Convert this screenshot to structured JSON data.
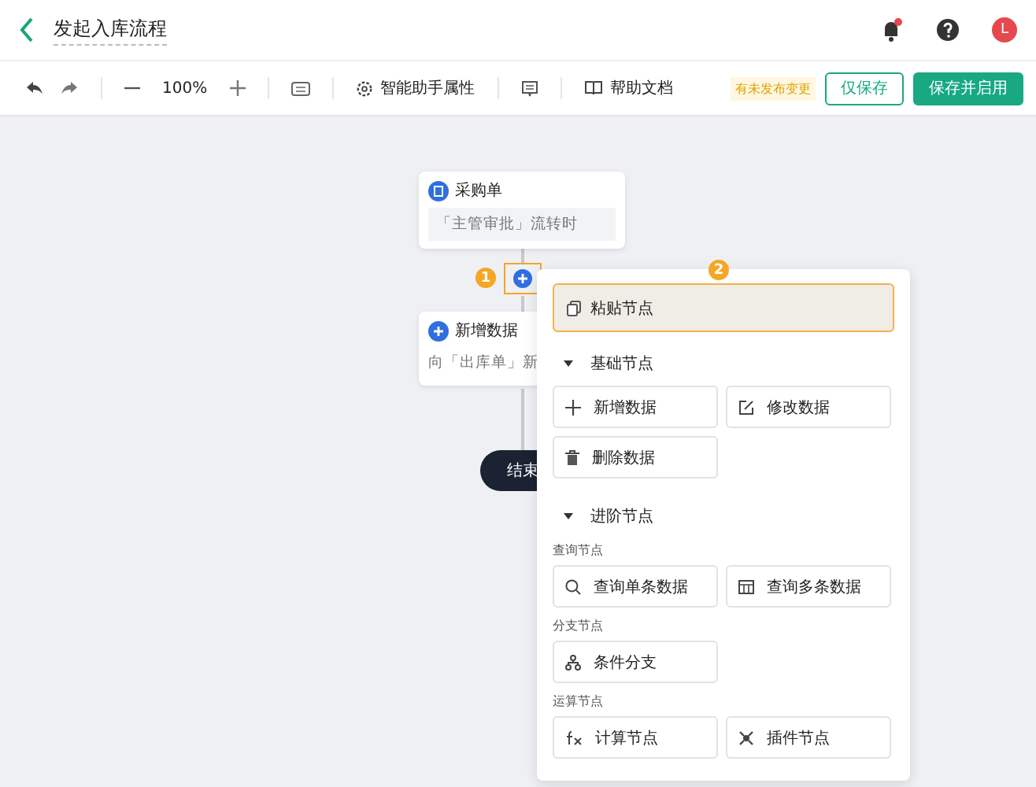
{
  "header": {
    "title": "发起入库流程",
    "avatar": "L",
    "notification_dot": true
  },
  "toolbar": {
    "zoom": "100%",
    "tools": [
      {
        "kind": "gear",
        "label": "智能助手属性"
      },
      {
        "kind": "note"
      },
      {
        "kind": "book",
        "label": "帮助文档"
      }
    ],
    "unpublished_badge": "有未发布变更",
    "buttons": [
      {
        "label": "仅保存",
        "kind": "outline"
      },
      {
        "label": "保存并启用",
        "kind": "primary"
      }
    ]
  },
  "canvas": {
    "nodes": [
      {
        "kind": "form",
        "title": "采购单",
        "subtitle": "「主管审批」流转时"
      },
      {
        "kind": "add",
        "title": "新增数据",
        "subtitle": "向「出库单」新"
      }
    ],
    "end_label": "结束",
    "step_markers": [
      "1",
      "2"
    ]
  },
  "menu": {
    "paste": {
      "label": "粘贴节点",
      "selected": true
    },
    "sections": [
      {
        "title": "基础节点",
        "expanded": true,
        "groups": [
          {
            "items": [
              {
                "kind": "plus",
                "label": "新增数据"
              },
              {
                "kind": "edit",
                "label": "修改数据"
              },
              {
                "kind": "trash",
                "label": "删除数据"
              }
            ]
          }
        ]
      },
      {
        "title": "进阶节点",
        "expanded": true,
        "groups": [
          {
            "title": "查询节点",
            "items": [
              {
                "kind": "search",
                "label": "查询单条数据"
              },
              {
                "kind": "table",
                "label": "查询多条数据"
              }
            ]
          },
          {
            "title": "分支节点",
            "items": [
              {
                "kind": "branch",
                "label": "条件分支"
              }
            ]
          },
          {
            "title": "运算节点",
            "items": [
              {
                "kind": "fx",
                "label": "计算节点"
              },
              {
                "kind": "plugin",
                "label": "插件节点"
              }
            ]
          }
        ]
      }
    ]
  }
}
